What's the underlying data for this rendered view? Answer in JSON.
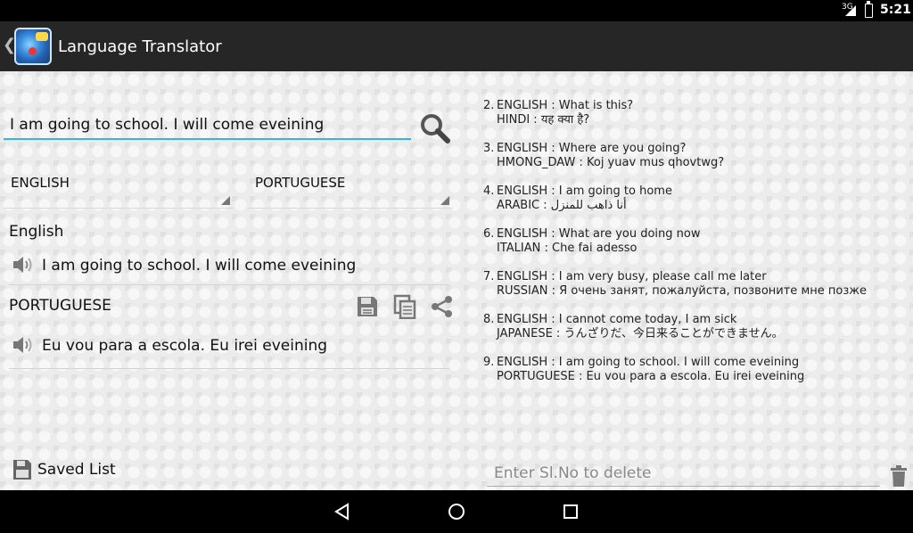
{
  "status_bar": {
    "network": "3G",
    "time": "5:21"
  },
  "app": {
    "title": "Language Translator"
  },
  "translator": {
    "query_value": "I am going to school. I will come eveining",
    "from_language": "ENGLISH",
    "to_language": "PORTUGUESE",
    "source_label": "English",
    "source_text": "I am going to school. I will come eveining",
    "target_label": "PORTUGUESE",
    "target_text": "Eu vou para a escola. Eu irei eveining"
  },
  "saved_list": {
    "label": "Saved List"
  },
  "history": [
    {
      "num": "2.",
      "line1": "ENGLISH : What is this?",
      "line2": "HINDI : यह क्या है?"
    },
    {
      "num": "3.",
      "line1": "ENGLISH : Where are you going?",
      "line2": "HMONG_DAW : Koj yuav mus qhovtwg?"
    },
    {
      "num": "4.",
      "line1": "ENGLISH : I am going to home",
      "line2": "ARABIC : أنا ذاهب للمنزل"
    },
    {
      "num": "6.",
      "line1": "ENGLISH : What are you doing now",
      "line2": "ITALIAN : Che fai adesso"
    },
    {
      "num": "7.",
      "line1": "ENGLISH : I am very busy, please call me later",
      "line2": "RUSSIAN : Я очень занят, пожалуйста, позвоните мне позже"
    },
    {
      "num": "8.",
      "line1": "ENGLISH : I cannot come today, I am sick",
      "line2": "JAPANESE : うんざりだ、今日来ることができません。"
    },
    {
      "num": "9.",
      "line1": "ENGLISH : I am going to school. I will come eveining",
      "line2": "PORTUGUESE : Eu vou para a escola. Eu irei eveining"
    }
  ],
  "delete": {
    "placeholder": "Enter Sl.No to delete"
  },
  "icons": {
    "search": "search-icon",
    "speaker": "speaker-icon",
    "save": "save-icon",
    "copy": "copy-icon",
    "share": "share-icon",
    "trash": "trash-icon",
    "back": "back-icon",
    "home": "home-icon",
    "recents": "recents-icon"
  },
  "colors": {
    "accent": "#33b5e5",
    "action_bar": "#262626",
    "background": "#ececec",
    "icon": "#666666"
  }
}
